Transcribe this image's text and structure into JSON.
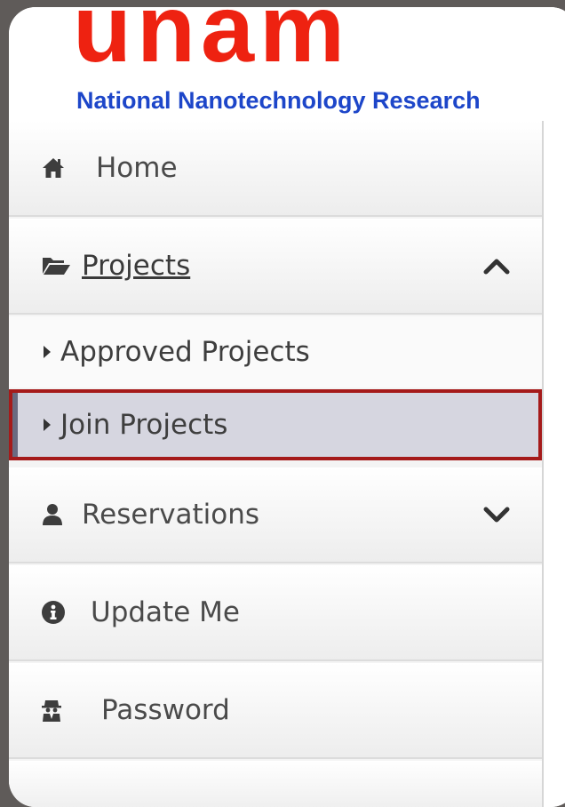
{
  "logo": {
    "word": "unam",
    "subtitle": "National Nanotechnology Research",
    "colors": {
      "word": "#ee2211",
      "subtitle": "#1d46c9"
    }
  },
  "nav": {
    "home": {
      "label": "Home",
      "icon": "home-icon"
    },
    "projects": {
      "label": "Projects",
      "icon": "folder-open-icon",
      "expanded": true,
      "children": [
        {
          "label": "Approved Projects"
        },
        {
          "label": "Join Projects",
          "selected": true
        }
      ]
    },
    "reservations": {
      "label": "Reservations",
      "icon": "user-icon",
      "expanded": false
    },
    "update_me": {
      "label": "Update Me",
      "icon": "info-circle-icon"
    },
    "password": {
      "label": "Password",
      "icon": "user-secret-icon"
    }
  },
  "colors": {
    "highlight_border": "#a51a1a",
    "highlight_bg": "#d6d6e0"
  }
}
